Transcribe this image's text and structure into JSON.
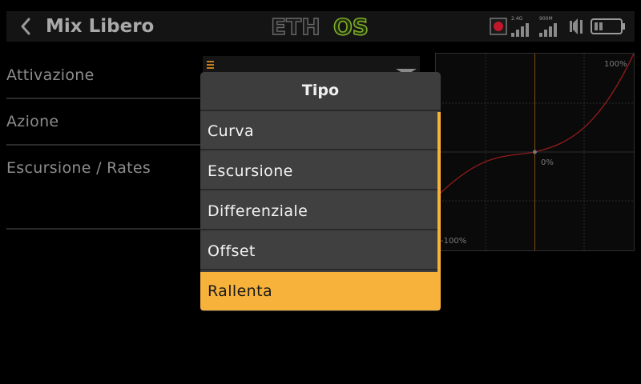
{
  "header": {
    "title": "Mix Libero",
    "logo_text_a": "ETH",
    "logo_text_b": "OS",
    "signal_a_label": "2.4G",
    "signal_b_label": "900M"
  },
  "rows": [
    {
      "label": "Attivazione"
    },
    {
      "label": "Azione"
    },
    {
      "label": "Escursione / Rates"
    }
  ],
  "graph": {
    "label_top": "100%",
    "label_center": "0%",
    "label_bottom": "-100%"
  },
  "dialog": {
    "title": "Tipo",
    "items": [
      {
        "label": "Curva"
      },
      {
        "label": "Escursione"
      },
      {
        "label": "Differenziale"
      },
      {
        "label": "Offset"
      },
      {
        "label": "Rallenta"
      }
    ],
    "selected": "Rallenta"
  },
  "colors": {
    "accent": "#f7b23b",
    "logo_green": "#7fae2e",
    "curve": "#8b1a1a"
  }
}
